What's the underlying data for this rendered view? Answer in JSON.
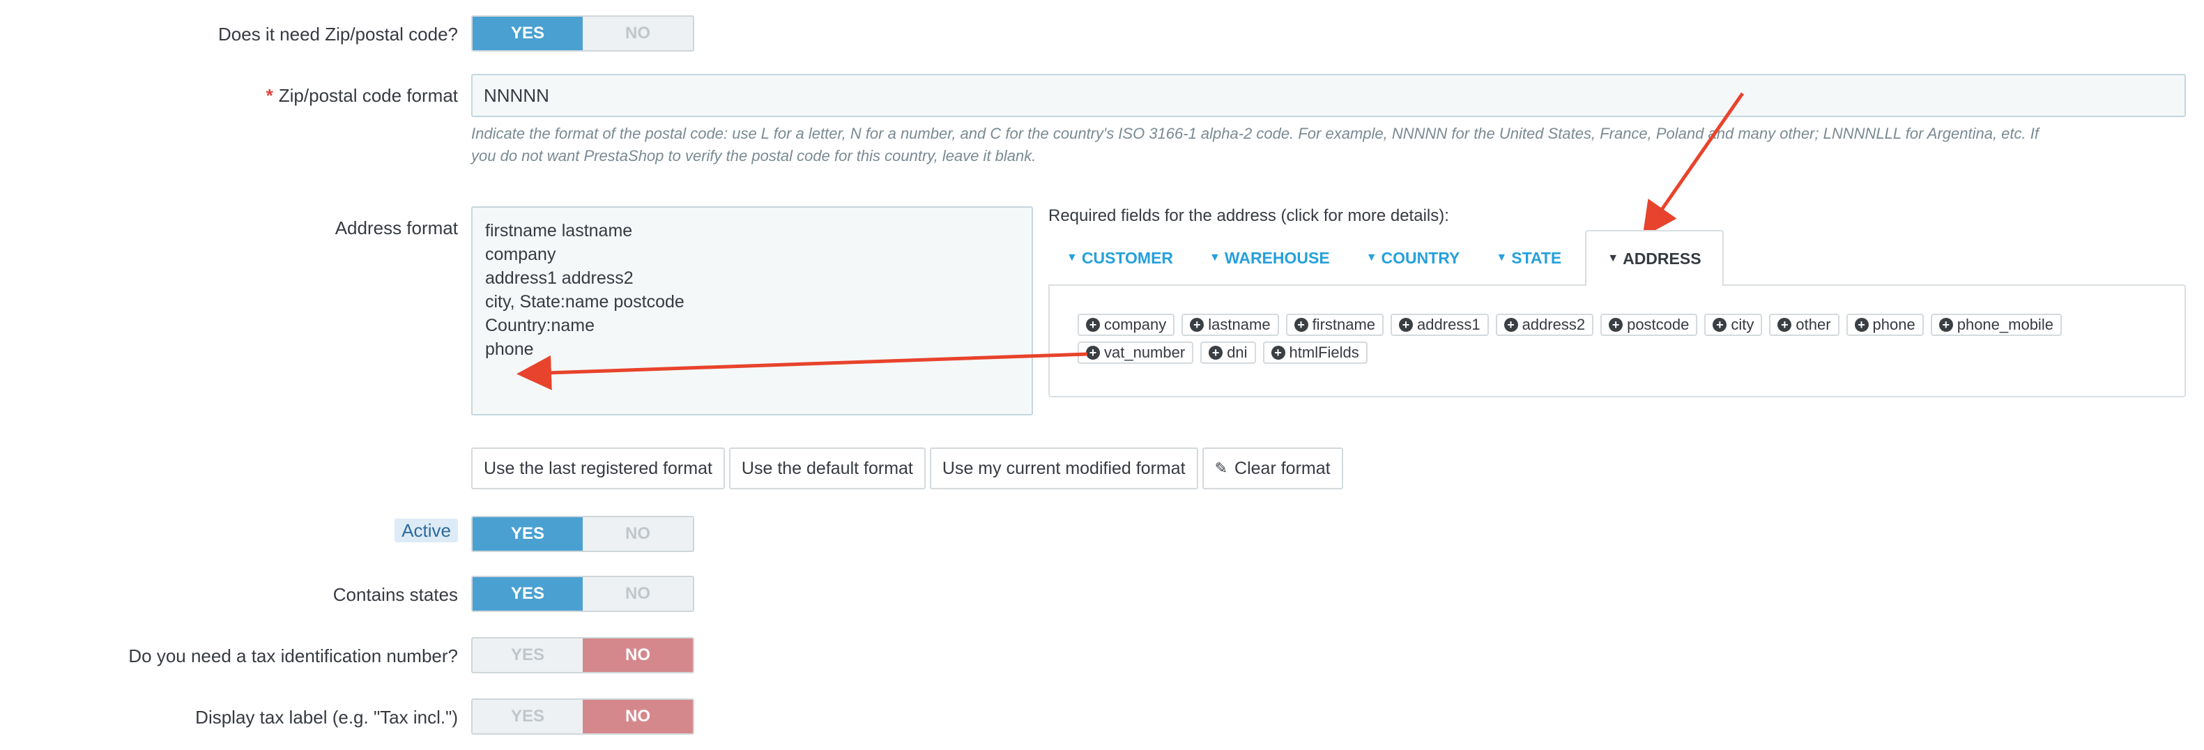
{
  "zip_needed": {
    "label": "Does it need Zip/postal code?",
    "yes": "YES",
    "no": "NO",
    "value": "yes"
  },
  "zip_format": {
    "required_mark": "*",
    "label": "Zip/postal code format",
    "value": "NNNNN",
    "help_line1": "Indicate the format of the postal code: use L for a letter, N for a number, and C for the country's ISO 3166-1 alpha-2 code. For example, NNNNN for the United States, France, Poland and many other; LNNNNLLL for Argentina, etc. If",
    "help_line2": "you do not want PrestaShop to verify the postal code for this country, leave it blank."
  },
  "address_format": {
    "label": "Address format",
    "lines": [
      "firstname lastname",
      "company",
      "address1 address2",
      "city, State:name postcode",
      "Country:name",
      "phone"
    ],
    "required_title": "Required fields for the address (click for more details):",
    "tabs": [
      "CUSTOMER",
      "WAREHOUSE",
      "COUNTRY",
      "STATE",
      "ADDRESS"
    ],
    "active_tab": "ADDRESS",
    "chips": [
      "company",
      "lastname",
      "firstname",
      "address1",
      "address2",
      "postcode",
      "city",
      "other",
      "phone",
      "phone_mobile",
      "vat_number",
      "dni",
      "htmlFields"
    ]
  },
  "format_buttons": {
    "last": "Use the last registered format",
    "default": "Use the default format",
    "current": "Use my current modified format",
    "clear": "Clear format"
  },
  "active": {
    "label": "Active",
    "yes": "YES",
    "no": "NO",
    "value": "yes"
  },
  "contains_states": {
    "label": "Contains states",
    "yes": "YES",
    "no": "NO",
    "value": "yes"
  },
  "tax_id": {
    "label": "Do you need a tax identification number?",
    "yes": "YES",
    "no": "NO",
    "value": "no"
  },
  "tax_label": {
    "label": "Display tax label (e.g. \"Tax incl.\")",
    "yes": "YES",
    "no": "NO",
    "value": "no"
  },
  "colors": {
    "accent": "#25a0dc",
    "switch_yes": "#4aa1d1",
    "switch_no": "#d5888c",
    "annotation_arrow": "#e8432c"
  }
}
